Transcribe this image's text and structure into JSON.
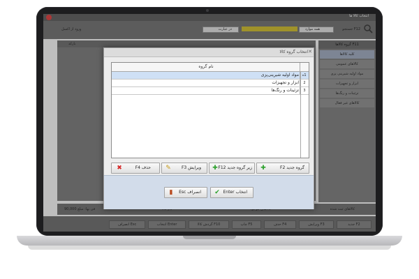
{
  "app": {
    "window_title": "انتخاب کالا ها",
    "toolbar": {
      "search_field_label": "جستجو F12",
      "field_label_1": "همه موارد",
      "field_label_2": "در عبارت",
      "import_label": "ورود از اکسل"
    },
    "grid": {
      "header_barcode": "بارکد"
    },
    "side": {
      "header": "گروه کالاها F11",
      "items": [
        "کلیه کالاها",
        "کالاهای عمومی",
        "مواد اولیه شیرینی پزی",
        "ابزار و تجهیزات",
        "تزئینات و رنگ‌ها",
        "کالاهای غیر فعال"
      ]
    },
    "status": {
      "text_1": "کالاهای ثبت شده",
      "text_2": "کالاهای موجود",
      "text_3": "نام کالا",
      "text_4": "فی بها: مبلغ 90,000"
    },
    "bottom_buttons": [
      "جدید F2",
      "ویرایش F3",
      "حذف F4",
      "چاپ F5",
      "گردش کالا F10",
      "انتخاب Enter",
      "انصراف Esc"
    ]
  },
  "dialog": {
    "title": "انتخاب گروه کالا",
    "table": {
      "header_name": "نام گروه",
      "rows": [
        {
          "num": "1",
          "name": "مواد اولیه شیرینی‌پزی",
          "selected": true
        },
        {
          "num": "2",
          "name": "ابزار و تجهیزات",
          "selected": false
        },
        {
          "num": "3",
          "name": "تزئینات و رنگ‌ها",
          "selected": false
        }
      ]
    },
    "buttons": {
      "new_group": "گروه جدید F2",
      "new_subgroup": "زیر گروه جدید F12",
      "edit": "ویرایش F3",
      "delete": "حذف F4",
      "select": "انتخاب Enter",
      "cancel": "انصراف Esc"
    }
  },
  "colors": {
    "selected_row": "#cfe0f5",
    "footer": "#d2dcea",
    "plus_icon": "#2da12d",
    "delete_icon": "#d62828"
  }
}
